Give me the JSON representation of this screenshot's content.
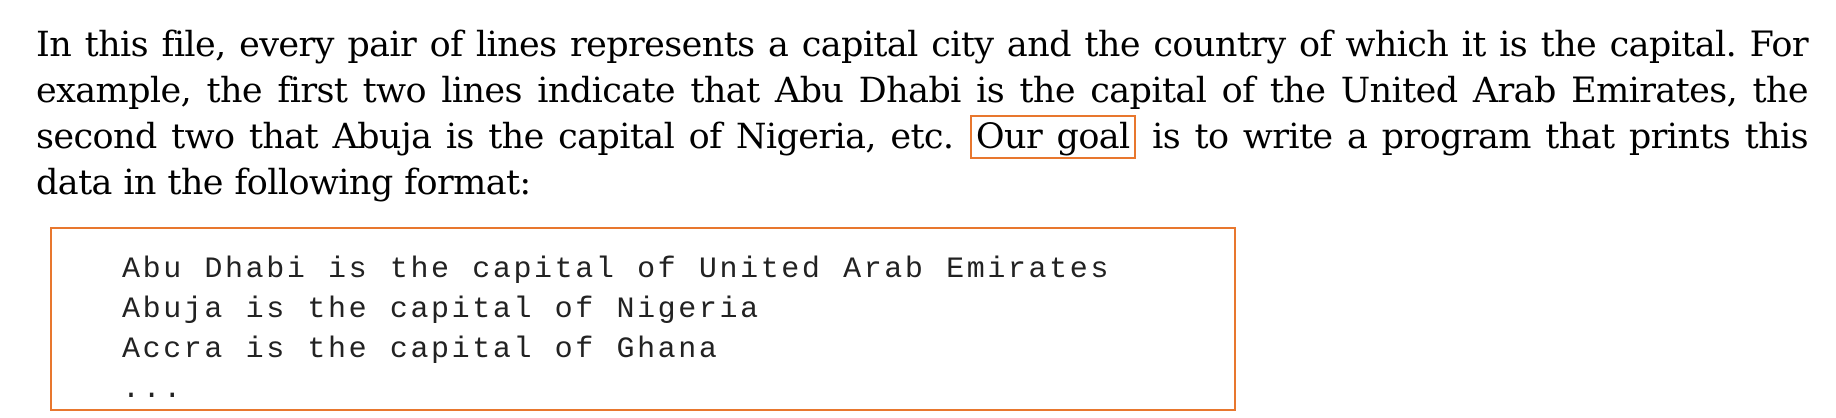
{
  "paragraph": {
    "before_highlight": "In this file, every pair of lines represents a capital city and the country of which it is the capital.  For example, the first two lines indicate that Abu Dhabi is the capital of the United Arab Emirates, the second two that Abuja is the capital of Nigeria, etc.",
    "highlight": "Our goal",
    "after_highlight": "is to write a program that prints this data in the following format:"
  },
  "code_block": {
    "lines": [
      "Abu Dhabi is the capital of United Arab Emirates",
      "Abuja is the capital of Nigeria",
      "Accra is the capital of Ghana",
      "..."
    ]
  },
  "colors": {
    "highlight_border": "#e8772e",
    "text": "#000000"
  }
}
